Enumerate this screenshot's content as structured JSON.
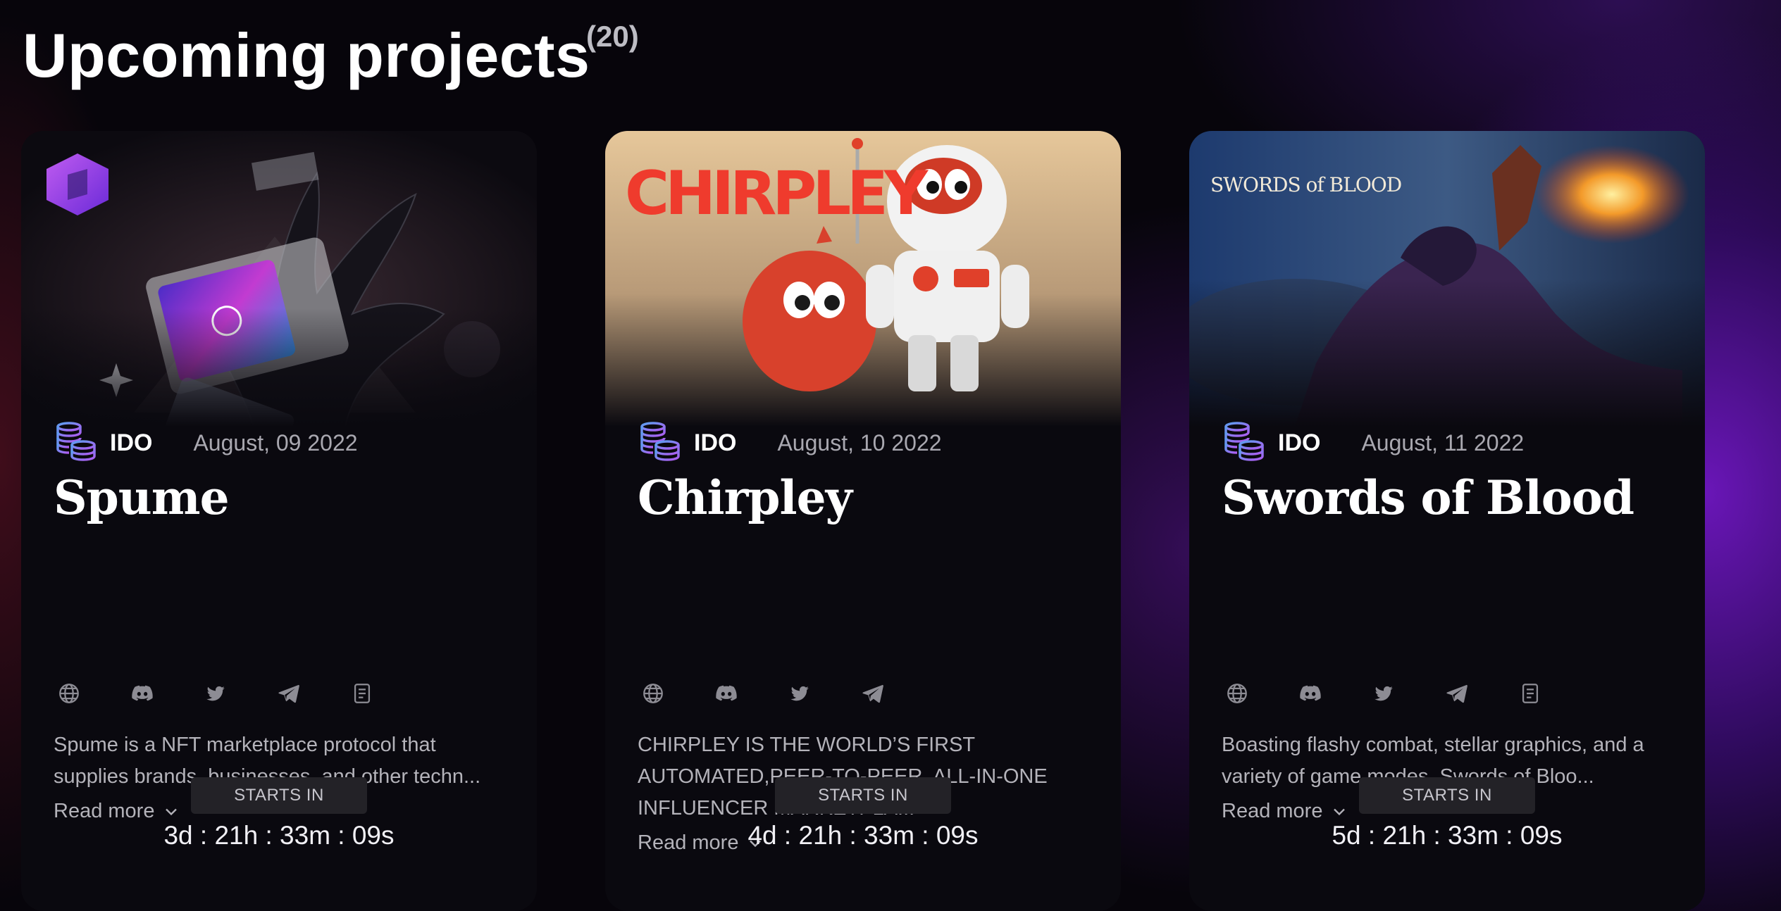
{
  "header": {
    "title": "Upcoming projects",
    "count": "(20)"
  },
  "projects": [
    {
      "type": "IDO",
      "date": "August, 09 2022",
      "name": "Spume",
      "description_lines": [
        "Spume is a NFT marketplace protocol that",
        "supplies brands, businesses, and other techn..."
      ],
      "read_more": "Read more",
      "starts_label": "STARTS IN",
      "countdown": "3d : 21h : 33m : 09s",
      "socials": [
        "globe-icon",
        "discord-icon",
        "twitter-icon",
        "telegram-icon",
        "document-icon"
      ]
    },
    {
      "type": "IDO",
      "date": "August, 10 2022",
      "name": "Chirpley",
      "brand_logo": "CHIRPLEY",
      "description_lines": [
        "CHIRPLEY IS THE WORLD’S FIRST",
        "AUTOMATED,PEER-TO-PEER, ALL-IN-ONE",
        "INFLUENCER MARKETPLA..."
      ],
      "read_more": "Read more",
      "starts_label": "STARTS IN",
      "countdown": "4d : 21h : 33m : 09s",
      "socials": [
        "globe-icon",
        "discord-icon",
        "twitter-icon",
        "telegram-icon"
      ]
    },
    {
      "type": "IDO",
      "date": "August, 11 2022",
      "name": "Swords of Blood",
      "brand_logo": "SWORDS of BLOOD",
      "description_lines": [
        "Boasting flashy combat, stellar graphics, and a",
        "variety of game modes, Swords of Bloo..."
      ],
      "read_more": "Read more",
      "starts_label": "STARTS IN",
      "countdown": "5d : 21h : 33m : 09s",
      "socials": [
        "globe-icon",
        "discord-icon",
        "twitter-icon",
        "telegram-icon",
        "document-icon"
      ]
    }
  ],
  "colors": {
    "accent_purple": "#8a3ff0",
    "card_bg": "#0a090f",
    "badge_bg": "#232227",
    "chirpley_red": "#ef3b2d"
  }
}
